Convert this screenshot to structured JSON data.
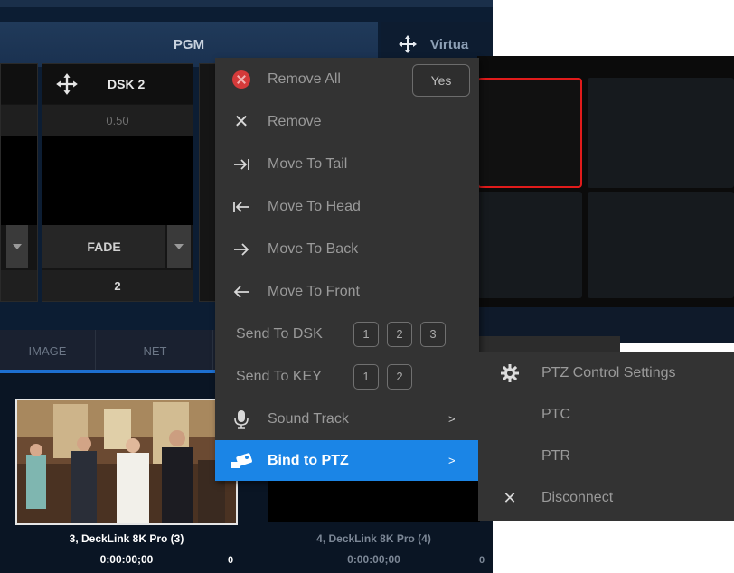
{
  "app": {
    "pgm_title": "PGM",
    "virtual_tab": "Virtua",
    "dsk_label": "DSK 2",
    "dsk_value": "0.50",
    "transition": "FADE",
    "transition_value": "2",
    "source_tabs": [
      "IMAGE",
      "NET"
    ],
    "sources": [
      {
        "name": "3, DeckLink 8K Pro (3)",
        "time": "0:00:00;00",
        "extra": "0"
      },
      {
        "name": "4, DeckLink 8K Pro (4)",
        "time": "0:00:00;00",
        "extra": "0"
      }
    ]
  },
  "context_menu": {
    "remove_all": "Remove All",
    "yes": "Yes",
    "remove": "Remove",
    "move_to_tail": "Move To Tail",
    "move_to_head": "Move To Head",
    "move_to_back": "Move To Back",
    "move_to_front": "Move To Front",
    "send_to_dsk": "Send To DSK",
    "dsk_buttons": [
      "1",
      "2",
      "3"
    ],
    "send_to_key": "Send To KEY",
    "key_buttons": [
      "1",
      "2"
    ],
    "sound_track": "Sound Track",
    "bind_to_ptz": "Bind to PTZ",
    "submenu_arrow": ">"
  },
  "ptz_submenu": {
    "control_settings": "PTZ Control Settings",
    "ptc": "PTC",
    "ptr": "PTR",
    "disconnect": "Disconnect"
  },
  "colors": {
    "menu_bg": "#333333",
    "highlight": "#1b85e6",
    "selected_border": "#e11b1b"
  }
}
